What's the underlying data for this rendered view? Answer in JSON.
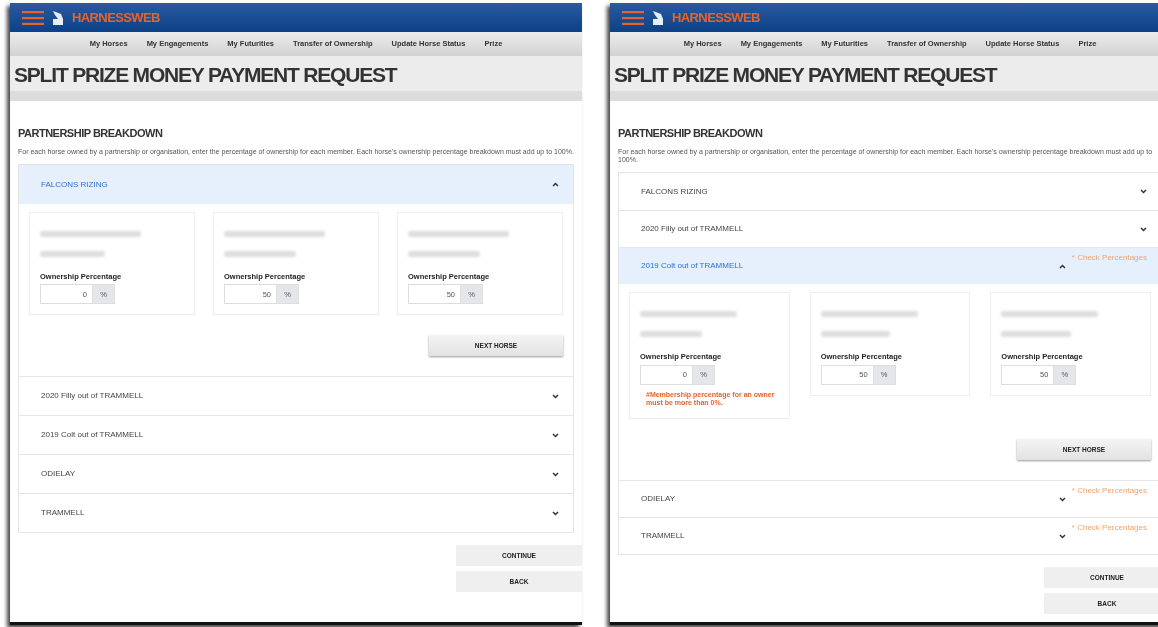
{
  "screens": [
    {
      "brand": "HARNESSWEB",
      "nav": [
        "My Horses",
        "My Engagements",
        "My Futurities",
        "Transfer of Ownership",
        "Update Horse Status",
        "Prize"
      ],
      "title": "SPLIT PRIZE MONEY PAYMENT REQUEST",
      "section_title": "PARTNERSHIP BREAKDOWN",
      "description": "For each horse owned by a partnership or organisation, enter the percentage of ownership for each member. Each horse's ownership percentage breakdown must add up to 100%.",
      "horses": [
        {
          "name": "FALCONS RIZING",
          "expanded": true,
          "members": [
            {
              "label": "Ownership Percentage",
              "value": "0",
              "unit": "%"
            },
            {
              "label": "Ownership Percentage",
              "value": "50",
              "unit": "%"
            },
            {
              "label": "Ownership Percentage",
              "value": "50",
              "unit": "%"
            }
          ],
          "next_button": "NEXT HORSE"
        },
        {
          "name": "2020 Filly out of TRAMMELL",
          "expanded": false
        },
        {
          "name": "2019 Colt out of TRAMMELL",
          "expanded": false
        },
        {
          "name": "ODIELAY",
          "expanded": false
        },
        {
          "name": "TRAMMELL",
          "expanded": false
        }
      ],
      "buttons": [
        "CONTINUE",
        "BACK"
      ]
    },
    {
      "brand": "HARNESSWEB",
      "nav": [
        "My Horses",
        "My Engagements",
        "My Futurities",
        "Transfer of Ownership",
        "Update Horse Status",
        "Prize"
      ],
      "title": "SPLIT PRIZE MONEY PAYMENT REQUEST",
      "section_title": "PARTNERSHIP BREAKDOWN",
      "description": "For each horse owned by a partnership or organisation, enter the percentage of ownership for each member. Each horse's ownership percentage breakdown must add up to 100%.",
      "horses": [
        {
          "name": "FALCONS RIZING",
          "expanded": false
        },
        {
          "name": "2020 Filly out of TRAMMELL",
          "expanded": false
        },
        {
          "name": "2019 Colt out of TRAMMELL",
          "expanded": true,
          "warning": "* Check Percentages",
          "members": [
            {
              "label": "Ownership Percentage",
              "value": "0",
              "unit": "%",
              "error": "#Membership percentage for an owner must be more than 0%."
            },
            {
              "label": "Ownership Percentage",
              "value": "50",
              "unit": "%"
            },
            {
              "label": "Ownership Percentage",
              "value": "50",
              "unit": "%"
            }
          ],
          "next_button": "NEXT HORSE"
        },
        {
          "name": "ODIELAY",
          "expanded": false,
          "warning": "* Check Percentages"
        },
        {
          "name": "TRAMMELL",
          "expanded": false,
          "warning": "* Check Percentages"
        }
      ],
      "buttons": [
        "CONTINUE",
        "BACK"
      ]
    }
  ]
}
